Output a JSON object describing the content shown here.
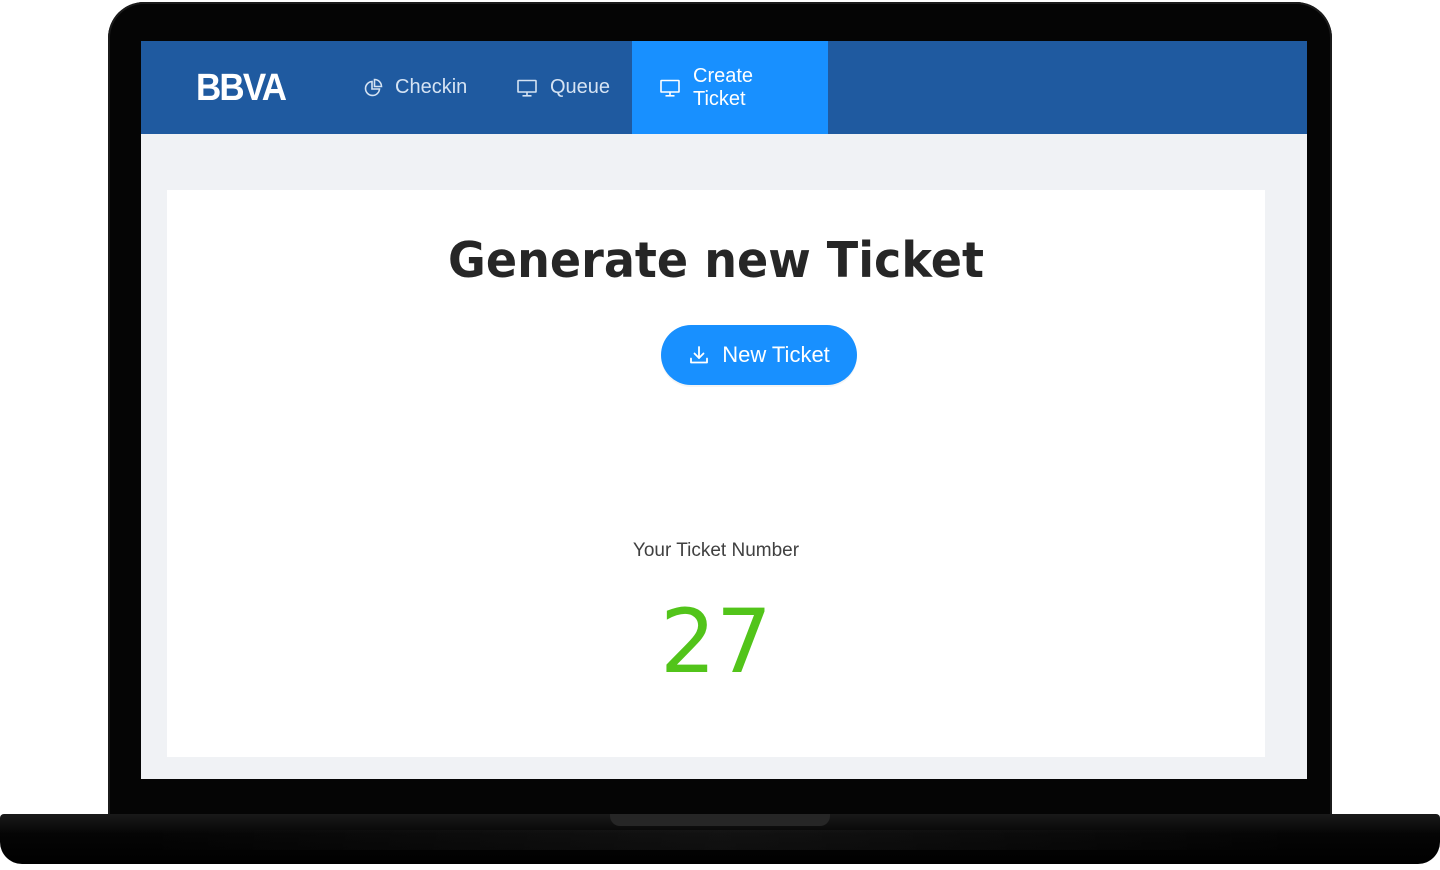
{
  "app": {
    "logo_text": "BBVA",
    "colors": {
      "header_bg": "#1f5aa0",
      "active_tab_bg": "#1890ff",
      "primary_button": "#1890ff",
      "ticket_number": "#52c41a",
      "page_bg": "#f0f2f5"
    }
  },
  "nav": {
    "items": [
      {
        "label": "Checkin",
        "icon": "pie-chart-icon",
        "active": false
      },
      {
        "label": "Queue",
        "icon": "desktop-icon",
        "active": false
      },
      {
        "label": "Create Ticket",
        "icon": "desktop-icon",
        "active": true
      }
    ]
  },
  "main": {
    "title": "Generate new Ticket",
    "new_ticket_button": {
      "label": "New Ticket",
      "icon": "download-icon"
    },
    "ticket_label": "Your Ticket Number",
    "ticket_number": "27"
  }
}
